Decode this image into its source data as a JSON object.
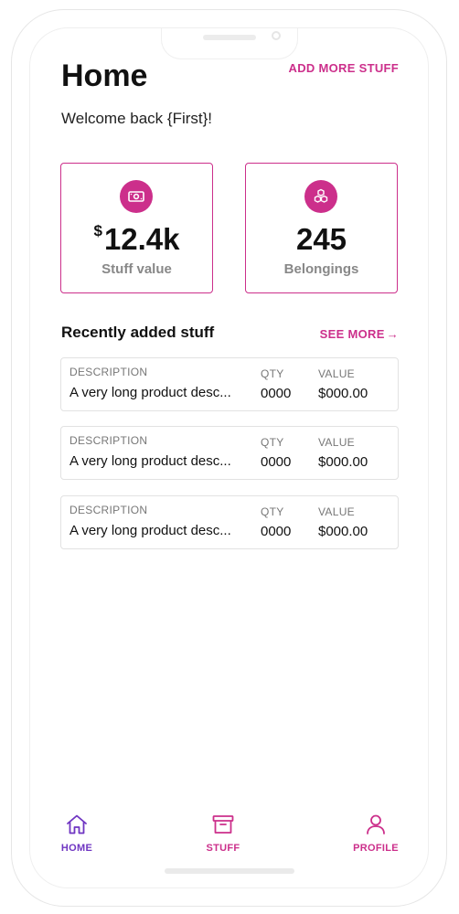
{
  "header": {
    "title": "Home",
    "add_link": "ADD MORE STUFF",
    "welcome": "Welcome back {First}!"
  },
  "stats": [
    {
      "icon": "cash-icon",
      "currency": "$",
      "value": "12.4k",
      "label": "Stuff value"
    },
    {
      "icon": "boxes-icon",
      "value": "245",
      "label": "Belongings"
    }
  ],
  "recent": {
    "title": "Recently added stuff",
    "see_more": "SEE MORE",
    "headers": {
      "description": "DESCRIPTION",
      "qty": "QTY",
      "value": "VALUE"
    },
    "items": [
      {
        "description": "A very long product desc...",
        "qty": "0000",
        "value": "$000.00"
      },
      {
        "description": "A very long product desc...",
        "qty": "0000",
        "value": "$000.00"
      },
      {
        "description": "A very long product desc...",
        "qty": "0000",
        "value": "$000.00"
      }
    ]
  },
  "nav": {
    "home": "HOME",
    "stuff": "STUFF",
    "profile": "PROFILE"
  },
  "colors": {
    "accent": "#cc2f8b",
    "active_nav": "#6f35c2"
  }
}
